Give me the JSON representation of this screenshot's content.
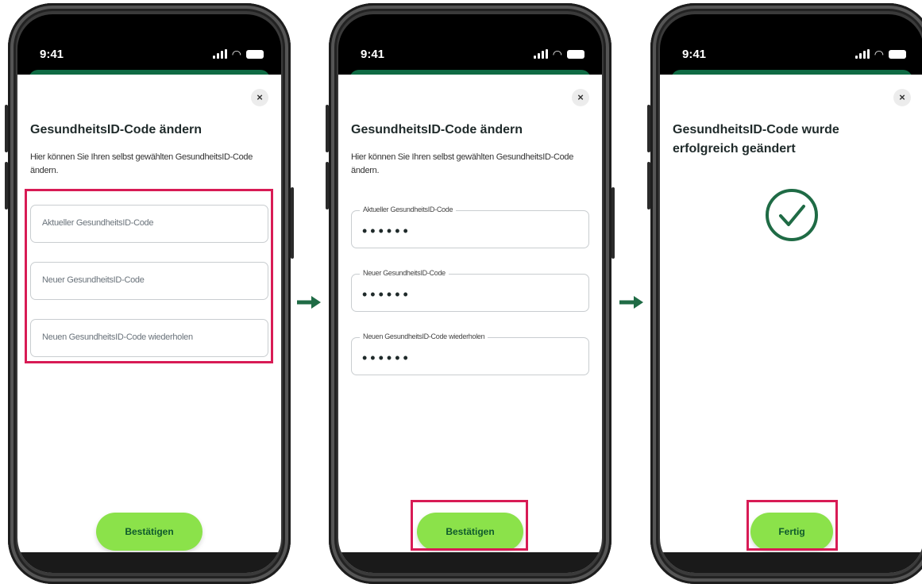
{
  "status_bar": {
    "time": "9:41"
  },
  "icons": {
    "close": "×",
    "signal": "signal-icon",
    "wifi": "wifi-icon",
    "battery": "battery-icon",
    "arrow": "arrow-right-icon",
    "check": "checkmark-circle-icon"
  },
  "colors": {
    "accent_green": "#0f6b44",
    "button_green": "#8be24a",
    "highlight": "#d81b55"
  },
  "screen1": {
    "title": "GesundheitsID-Code  ändern",
    "description": "Hier können Sie Ihren selbst gewählten GesundheitsID-Code ändern.",
    "field_current_placeholder": "Aktueller GesundheitsID-Code",
    "field_new_placeholder": "Neuer GesundheitsID-Code",
    "field_repeat_placeholder": "Neuen GesundheitsID-Code wiederholen",
    "confirm_label": "Bestätigen"
  },
  "screen2": {
    "title": "GesundheitsID-Code  ändern",
    "description": "Hier können Sie Ihren selbst gewählten GesundheitsID-Code ändern.",
    "field_current_label": "Aktueller GesundheitsID-Code",
    "field_current_value": "••••••",
    "field_new_label": "Neuer GesundheitsID-Code",
    "field_new_value": "••••••",
    "field_repeat_label": "Neuen GesundheitsID-Code wiederholen",
    "field_repeat_value": "••••••",
    "confirm_label": "Bestätigen"
  },
  "screen3": {
    "title": "GesundheitsID-Code wurde erfolgreich geändert",
    "done_label": "Fertig"
  }
}
